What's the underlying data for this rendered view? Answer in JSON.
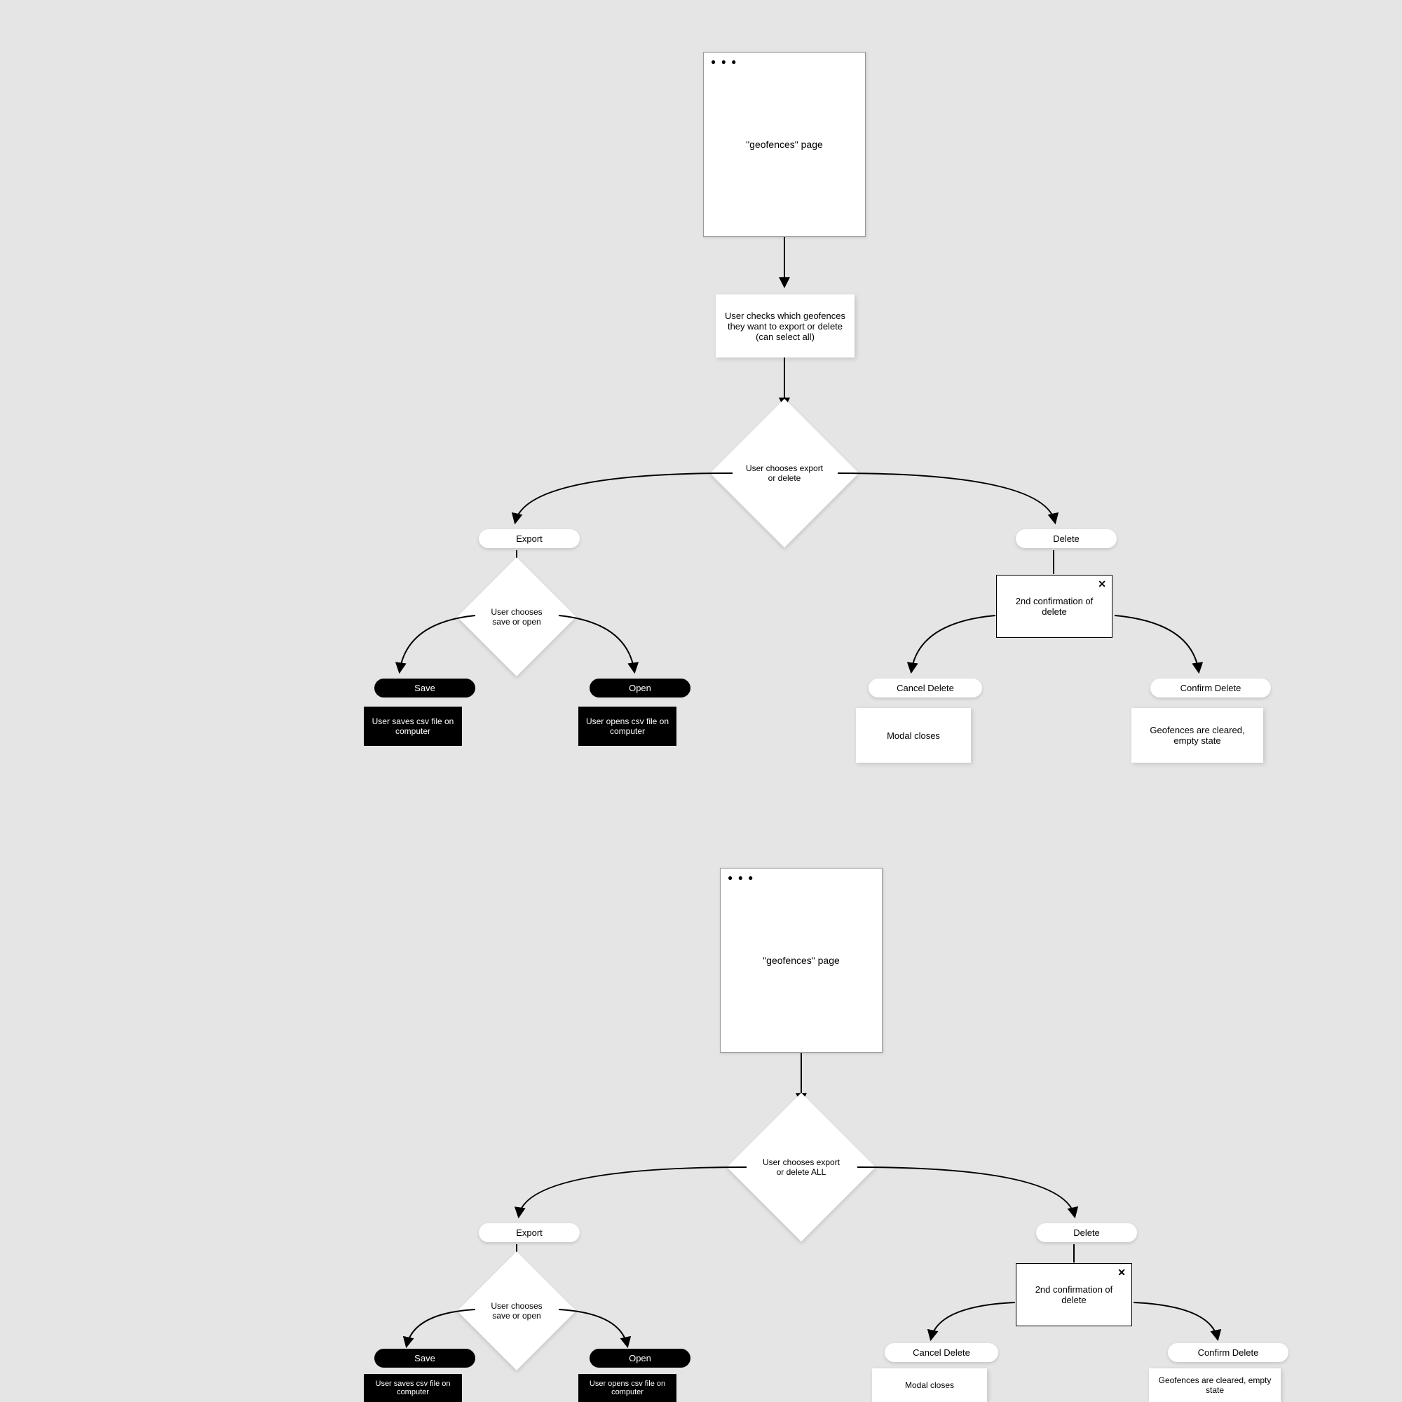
{
  "flow1": {
    "start_page": "\"geofences\" page",
    "checks": "User checks which geofences they want to export or delete (can select all)",
    "decision": "User chooses export or delete",
    "export_label": "Export",
    "delete_label": "Delete",
    "save_or_open": "User chooses save or open",
    "save_label": "Save",
    "open_label": "Open",
    "save_result": "User saves csv file on computer",
    "open_result": "User opens csv file on computer",
    "confirm_modal": "2nd confirmation of delete",
    "cancel_delete": "Cancel Delete",
    "confirm_delete": "Confirm Delete",
    "cancel_result": "Modal closes",
    "confirm_result": "Geofences are cleared, empty state"
  },
  "flow2": {
    "start_page": "\"geofences\" page",
    "decision": "User chooses export or delete ALL",
    "export_label": "Export",
    "delete_label": "Delete",
    "save_or_open": "User chooses save or open",
    "save_label": "Save",
    "open_label": "Open",
    "save_result": "User saves csv file on computer",
    "open_result": "User opens csv file on computer",
    "confirm_modal": "2nd confirmation of delete",
    "cancel_delete": "Cancel Delete",
    "confirm_delete": "Confirm Delete",
    "cancel_result": "Modal closes",
    "confirm_result": "Geofences are cleared, empty state"
  },
  "icons": {
    "close": "✕",
    "dots": "● ● ●"
  }
}
